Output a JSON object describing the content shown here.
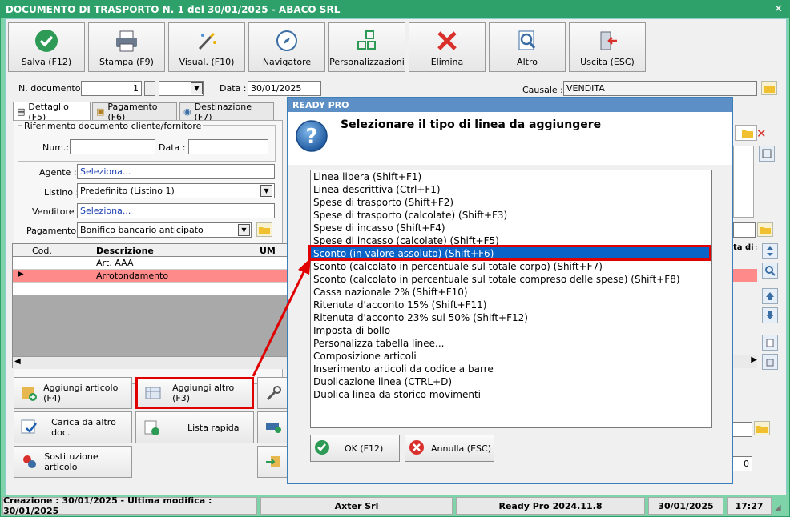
{
  "window": {
    "title": "DOCUMENTO DI TRASPORTO N. 1 del 30/01/2025 - ABACO SRL"
  },
  "toolbar": [
    {
      "label": "Salva (F12)",
      "icon": "check-icon"
    },
    {
      "label": "Stampa (F9)",
      "icon": "printer-icon"
    },
    {
      "label": "Visual. (F10)",
      "icon": "magic-wand-icon"
    },
    {
      "label": "Navigatore",
      "icon": "compass-icon"
    },
    {
      "label": "Personalizzazioni",
      "icon": "grid-icon"
    },
    {
      "label": "Elimina",
      "icon": "delete-x-icon"
    },
    {
      "label": "Altro",
      "icon": "search-doc-icon"
    },
    {
      "label": "Uscita (ESC)",
      "icon": "exit-door-icon"
    }
  ],
  "header": {
    "ndoc_label": "N. documento :",
    "ndoc_value": "1",
    "data_label": "Data :",
    "data_value": "30/01/2025",
    "causale_label": "Causale :",
    "causale_value": "VENDITA"
  },
  "tabs": [
    "Dettaglio (F5)",
    "Pagamento (F6)",
    "Destinazione (F7)"
  ],
  "form": {
    "riferimento_title": "Riferimento documento cliente/fornitore",
    "num_label": "Num.:",
    "data_label": "Data :",
    "agente_label": "Agente :",
    "agente_value": "Seleziona...",
    "listino_label": "Listino :",
    "listino_value": "Predefinito (Listino 1)",
    "venditore_label": "Venditore :",
    "venditore_value": "Seleziona...",
    "pagamento_label": "Pagamento :",
    "pagamento_value": "Bonifico bancario anticipato"
  },
  "grid": {
    "columns": [
      "Cod.",
      "Descrizione",
      "UM"
    ],
    "rows": [
      {
        "cod": "",
        "descrizione": "Art. AAA",
        "um": ""
      },
      {
        "cod": "",
        "descrizione": "Arrotondamento",
        "um": ""
      }
    ],
    "right_col_header": "ta di s"
  },
  "buttons": {
    "aggiungi_articolo": "Aggiungi articolo (F4)",
    "aggiungi_altro": "Aggiungi altro (F3)",
    "carica": "Carica da altro doc.",
    "lista_rapida": "Lista rapida",
    "sostituzione": "Sostituzione articolo"
  },
  "right_value": "0",
  "statusbar": {
    "creazione": "Creazione : 30/01/2025 - Ultima modifica : 30/01/2025",
    "company": "Axter Srl",
    "version": "Ready Pro 2024.11.8",
    "date": "30/01/2025",
    "time": "17:27"
  },
  "dialog": {
    "title": "READY PRO",
    "question": "Selezionare il tipo di linea da aggiungere",
    "items": [
      "Linea libera (Shift+F1)",
      "Linea descrittiva (Ctrl+F1)",
      "Spese di trasporto (Shift+F2)",
      "Spese di trasporto (calcolate) (Shift+F3)",
      "Spese di incasso (Shift+F4)",
      "Spese di incasso (calcolate) (Shift+F5)",
      "Sconto (in valore assoluto) (Shift+F6)",
      "Sconto (calcolato in percentuale sul totale corpo) (Shift+F7)",
      "Sconto (calcolato in percentuale sul totale compreso delle spese) (Shift+F8)",
      "Cassa nazionale 2% (Shift+F10)",
      "Ritenuta d'acconto 15% (Shift+F11)",
      "Ritenuta d'acconto 23% sul 50% (Shift+F12)",
      "Imposta di bollo",
      "Personalizza tabella linee...",
      "Composizione articoli",
      "Inserimento articoli da codice a barre",
      "Duplicazione linea (CTRL+D)",
      "Duplica linea da storico movimenti"
    ],
    "selected_index": 6,
    "ok_label": "OK (F12)",
    "cancel_label": "Annulla (ESC)"
  },
  "colors": {
    "title_bar": "#2ea06a",
    "highlight": "#e00000",
    "selection": "#0a64c8",
    "row_highlight": "#ff8a8a"
  }
}
